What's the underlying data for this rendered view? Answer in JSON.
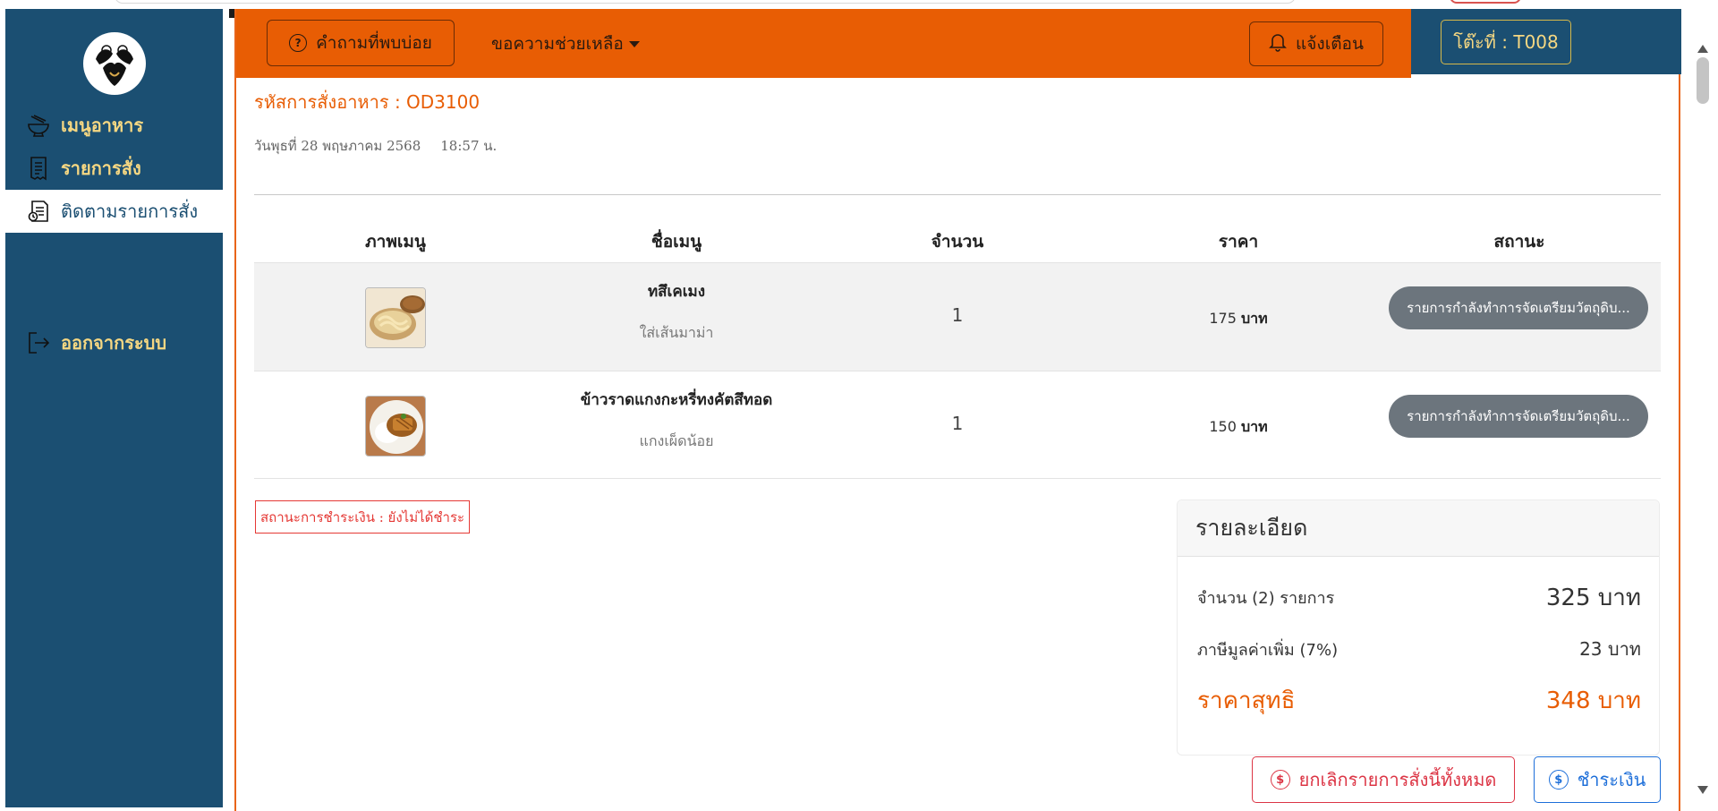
{
  "sidebar": {
    "items": [
      {
        "label": "เมนูอาหาร",
        "icon": "noodle-bowl-icon"
      },
      {
        "label": "รายการสั่ง",
        "icon": "receipt-icon"
      },
      {
        "label": "ติดตามรายการสั่ง",
        "icon": "order-tracking-icon"
      },
      {
        "label": "ออกจากระบบ",
        "icon": "logout-icon"
      }
    ],
    "active_index": 2
  },
  "header": {
    "faq_label": "คำถามที่พบบ่อย",
    "help_label": "ขอความช่วยเหลือ",
    "notify_label": "แจ้งเตือน",
    "table_label": "โต๊ะที่ : T008"
  },
  "order": {
    "code_label": "รหัสการสั่งอาหาร : OD3100",
    "date": "วันพุธที่ 28 พฤษภาคม 2568",
    "time": "18:57 น."
  },
  "table": {
    "columns": [
      "ภาพเมนู",
      "ชื่อเมนู",
      "จำนวน",
      "ราคา",
      "สถานะ"
    ],
    "rows": [
      {
        "name": "ทสึเคเมง",
        "note": "ใส่เส้นมาม่า",
        "qty": "1",
        "price": "175",
        "unit": "บาท",
        "status": "รายการกำลังทำการจัดเตรียมวัตถุดิบ..."
      },
      {
        "name": "ข้าวราดแกงกะหรี่ทงคัตสึทอด",
        "note": "แกงเผ็ดน้อย",
        "qty": "1",
        "price": "150",
        "unit": "บาท",
        "status": "รายการกำลังทำการจัดเตรียมวัตถุดิบ..."
      }
    ]
  },
  "payment_status": "สถานะการชำระเงิน : ยังไม่ได้ชำระ",
  "summary": {
    "title": "รายละเอียด",
    "items_label": "จำนวน (2) รายการ",
    "items_value": "325 บาท",
    "vat_label": "ภาษีมูลค่าเพิ่ม (7%)",
    "vat_value": "23 บาท",
    "net_label": "ราคาสุทธิ",
    "net_value": "348 บาท"
  },
  "actions": {
    "cancel_label": "ยกเลิกรายการสั่งนี้ทั้งหมด",
    "pay_label": "ชำระเงิน"
  },
  "colors": {
    "sidebar": "#1b4f72",
    "header": "#e85d04",
    "accent_text": "#e85d04",
    "nav_text": "#f5d782",
    "status_pill": "#6c757d",
    "danger": "#dc3545",
    "primary": "#1e6fd9"
  }
}
